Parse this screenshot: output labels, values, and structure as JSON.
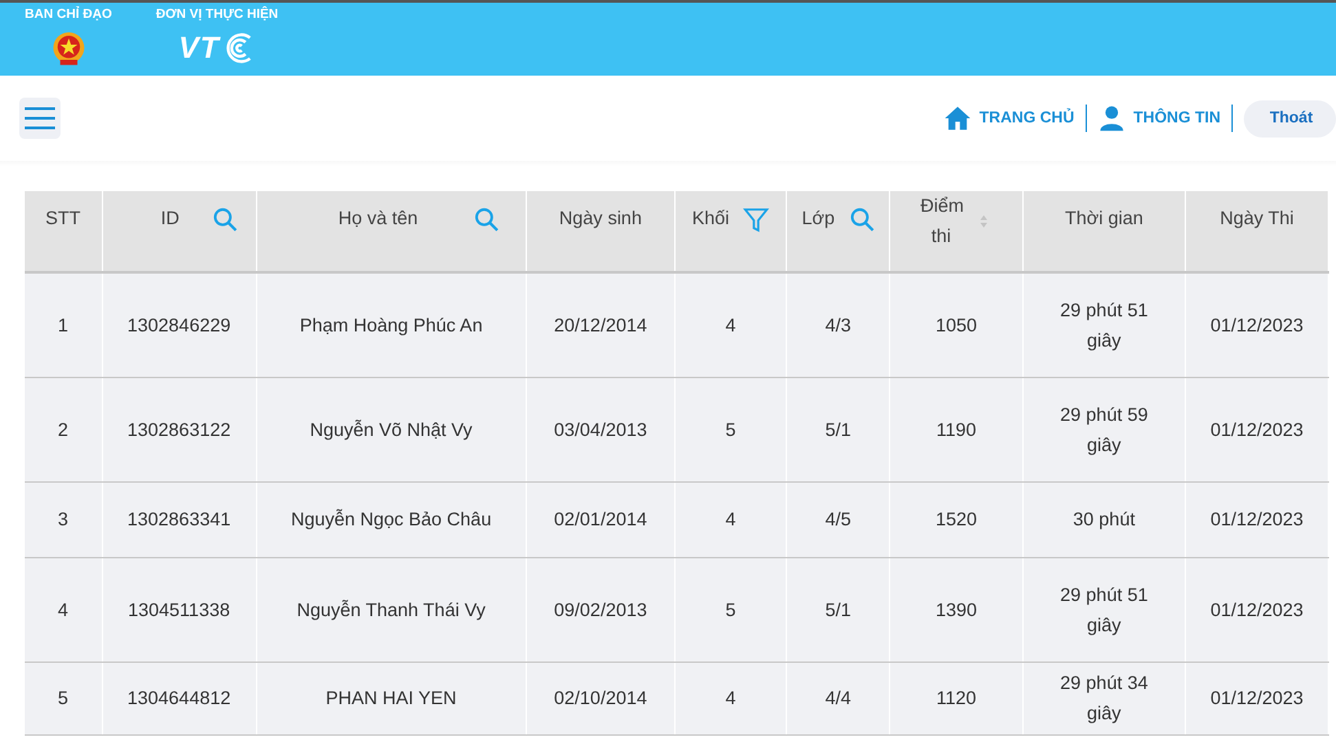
{
  "header": {
    "groups": [
      {
        "label": "BAN CHỈ ĐẠO",
        "kind": "emblem"
      },
      {
        "label": "ĐƠN VỊ THỰC HIỆN",
        "kind": "logo",
        "logo_text": "VT"
      }
    ]
  },
  "nav": {
    "links": [
      {
        "label": "TRANG CHỦ",
        "kind": "home"
      },
      {
        "label": "THÔNG TIN",
        "kind": "user"
      }
    ],
    "logout": "Thoát"
  },
  "table": {
    "columns": [
      {
        "label": "STT",
        "kind": "plain"
      },
      {
        "label": "ID",
        "kind": "search"
      },
      {
        "label": "Họ và tên",
        "kind": "search"
      },
      {
        "label": "Ngày sinh",
        "kind": "plain"
      },
      {
        "label": "Khối",
        "kind": "filter"
      },
      {
        "label": "Lớp",
        "kind": "search"
      },
      {
        "label": "Điểm thi",
        "kind": "sort"
      },
      {
        "label": "Thời gian",
        "kind": "plain"
      },
      {
        "label": "Ngày Thi",
        "kind": "plain"
      }
    ],
    "rows": [
      [
        "1",
        "1302846229",
        "Phạm Hoàng Phúc An",
        "20/12/2014",
        "4",
        "4/3",
        "1050",
        "29 phút 51 giây",
        "01/12/2023"
      ],
      [
        "2",
        "1302863122",
        "Nguyễn Võ Nhật Vy",
        "03/04/2013",
        "5",
        "5/1",
        "1190",
        "29 phút 59 giây",
        "01/12/2023"
      ],
      [
        "3",
        "1302863341",
        "Nguyễn Ngọc Bảo Châu",
        "02/01/2014",
        "4",
        "4/5",
        "1520",
        "30 phút",
        "01/12/2023"
      ],
      [
        "4",
        "1304511338",
        "Nguyễn Thanh Thái Vy",
        "09/02/2013",
        "5",
        "5/1",
        "1390",
        "29 phút 51 giây",
        "01/12/2023"
      ],
      [
        "5",
        "1304644812",
        "PHAN HAI YEN",
        "02/10/2014",
        "4",
        "4/4",
        "1120",
        "29 phút 34 giây",
        "01/12/2023"
      ]
    ]
  }
}
